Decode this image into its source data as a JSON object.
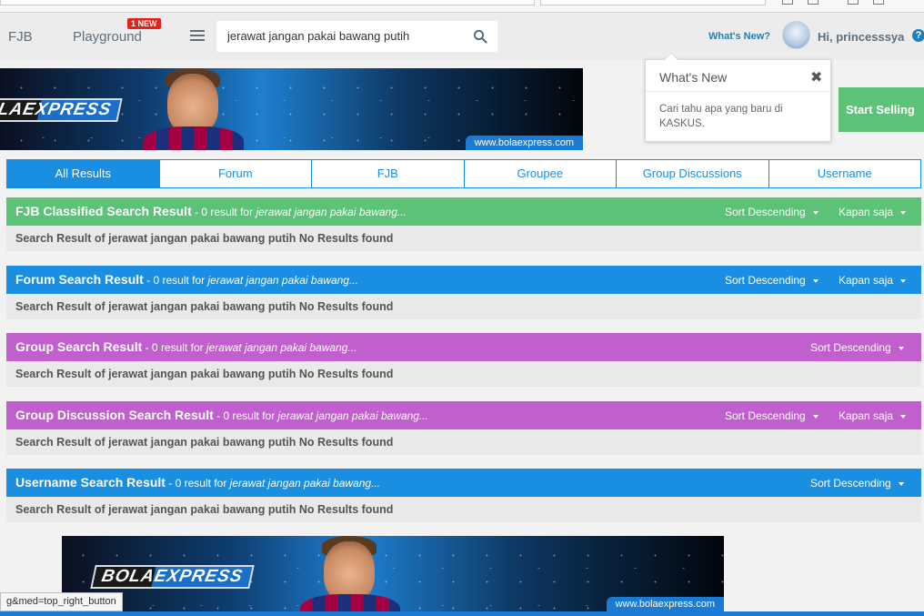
{
  "nav": {
    "fjb": "FJB",
    "playground": "Playground",
    "new_badge": "1 NEW",
    "search_value": "jerawat jangan pakai bawang putih",
    "whats_new": "What's New?",
    "greeting": "Hi, princesssya",
    "help": "?"
  },
  "banner": {
    "logo_left": "LA",
    "logo_left_suffix": "EXPRESS",
    "logo_bottom": "BOLA",
    "logo_bottom_suffix": "EXPRESS",
    "url": "www.bolaexpress.com"
  },
  "popover": {
    "title": "What's New",
    "close": "✖",
    "body": "Cari tahu apa yang baru di KASKUS."
  },
  "start_selling": "Start Selling",
  "tabs": [
    "All Results",
    "Forum",
    "FJB",
    "Groupee",
    "Group Discussions",
    "Username"
  ],
  "results": [
    {
      "title": "FJB Classified Search Result",
      "count_text": " - 0 result for ",
      "query": "jerawat jangan pakai bawang...",
      "sort": "Sort Descending",
      "time": "Kapan saja",
      "color": "#5bc277",
      "empty": "Search Result of jerawat jangan pakai bawang putih No Results found"
    },
    {
      "title": "Forum Search Result",
      "count_text": " - 0 result for ",
      "query": "jerawat jangan pakai bawang...",
      "sort": "Sort Descending",
      "time": "Kapan saja",
      "color": "#1a8ee0",
      "empty": "Search Result of jerawat jangan pakai bawang putih No Results found"
    },
    {
      "title": "Group Search Result",
      "count_text": " - 0 result for ",
      "query": "jerawat jangan pakai bawang...",
      "sort": "Sort Descending",
      "color": "#c25fcf",
      "empty": "Search Result of jerawat jangan pakai bawang putih No Results found"
    },
    {
      "title": "Group Discussion Search Result",
      "count_text": " - 0 result for ",
      "query": "jerawat jangan pakai bawang...",
      "sort": "Sort Descending",
      "time": "Kapan saja",
      "color": "#c25fcf",
      "empty": "Search Result of jerawat jangan pakai bawang putih No Results found"
    },
    {
      "title": "Username Search Result",
      "count_text": " - 0 result for ",
      "query": "jerawat jangan pakai bawang...",
      "sort": "Sort Descending",
      "color": "#1a8ee0",
      "empty": "Search Result of jerawat jangan pakai bawang putih No Results found"
    }
  ],
  "status_url": "g&med=top_right_button"
}
